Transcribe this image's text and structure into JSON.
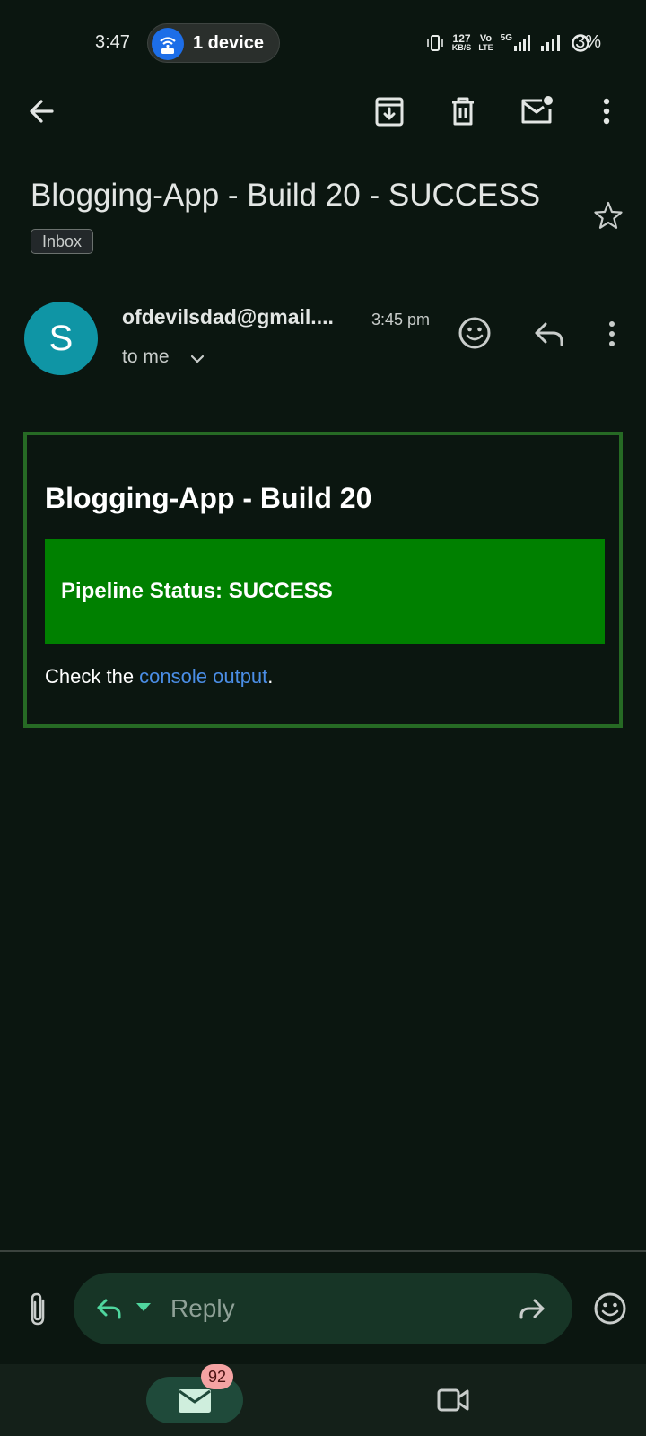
{
  "status_bar": {
    "time": "3:47",
    "device_label": "1 device",
    "net_speed_value": "127",
    "net_speed_unit": "KB/S",
    "volte_top": "Vo",
    "volte_bottom": "LTE",
    "network_type": "5G",
    "battery": "3%"
  },
  "toolbar": {
    "back_icon": "arrow-left-icon",
    "archive_icon": "archive-icon",
    "delete_icon": "trash-icon",
    "mark_unread_icon": "mark-unread-icon",
    "more_icon": "more-vertical-icon"
  },
  "message": {
    "subject": "Blogging-App - Build 20 - SUCCESS",
    "label": "Inbox",
    "avatar_letter": "S",
    "sender": "ofdevilsdad@gmail....",
    "time": "3:45 pm",
    "recipient": "to me"
  },
  "email_body": {
    "heading": "Blogging-App - Build 20",
    "status": "Pipeline Status: SUCCESS",
    "check_prefix": "Check the ",
    "link_text": "console output",
    "check_suffix": "."
  },
  "reply_bar": {
    "placeholder": "Reply"
  },
  "bottom_nav": {
    "mail_badge": "92"
  },
  "colors": {
    "background": "#0b1610",
    "avatar": "#0f95a5",
    "card_border": "#266a24",
    "status_banner": "#008000",
    "link": "#4b8ee6",
    "badge": "#f4a3a3"
  }
}
